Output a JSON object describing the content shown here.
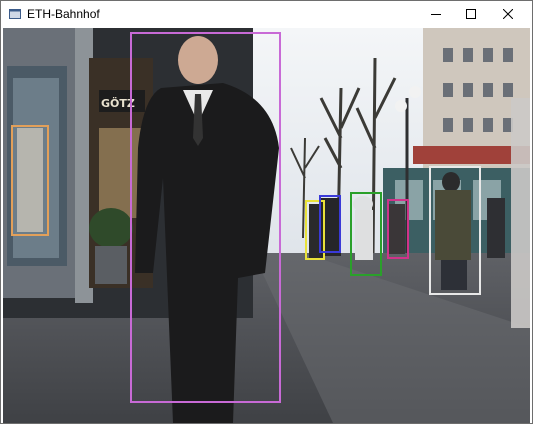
{
  "window": {
    "title": "ETH-Bahnhof",
    "controls": [
      "minimize",
      "maximize",
      "close"
    ]
  },
  "viewport": {
    "store_sign": "GÖTZ",
    "detections": [
      {
        "label": "pedestrian",
        "color": "#e2a05a"
      },
      {
        "label": "pedestrian",
        "color": "#c86ad6"
      },
      {
        "label": "pedestrian",
        "color": "#e9e23a"
      },
      {
        "label": "pedestrian",
        "color": "#3a3ad8"
      },
      {
        "label": "pedestrian",
        "color": "#2aa02a"
      },
      {
        "label": "pedestrian",
        "color": "#d0338a"
      },
      {
        "label": "pedestrian",
        "color": "#e8e8e8"
      }
    ]
  }
}
